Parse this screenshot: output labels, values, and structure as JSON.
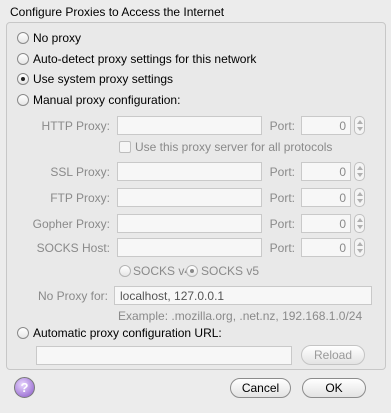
{
  "title": "Configure Proxies to Access the Internet",
  "options": {
    "no_proxy": "No proxy",
    "auto_detect": "Auto-detect proxy settings for this network",
    "system": "Use system proxy settings",
    "manual": "Manual proxy configuration:",
    "auto_url": "Automatic proxy configuration URL:"
  },
  "selected_option": "system",
  "manual": {
    "http_label": "HTTP Proxy:",
    "ssl_label": "SSL Proxy:",
    "ftp_label": "FTP Proxy:",
    "gopher_label": "Gopher Proxy:",
    "socks_label": "SOCKS Host:",
    "port_label": "Port:",
    "http_port": "0",
    "ssl_port": "0",
    "ftp_port": "0",
    "gopher_port": "0",
    "socks_port": "0",
    "share_label": "Use this proxy server for all protocols",
    "socks_v4": "SOCKS v4",
    "socks_v5": "SOCKS v5",
    "socks_selected": "v5",
    "no_proxy_label": "No Proxy for:",
    "no_proxy_value": "localhost, 127.0.0.1",
    "example": "Example: .mozilla.org, .net.nz, 192.168.1.0/24"
  },
  "reload_label": "Reload",
  "buttons": {
    "cancel": "Cancel",
    "ok": "OK",
    "help": "?"
  },
  "icons": {
    "help": "help-icon",
    "stepper": "stepper-arrows-icon"
  }
}
